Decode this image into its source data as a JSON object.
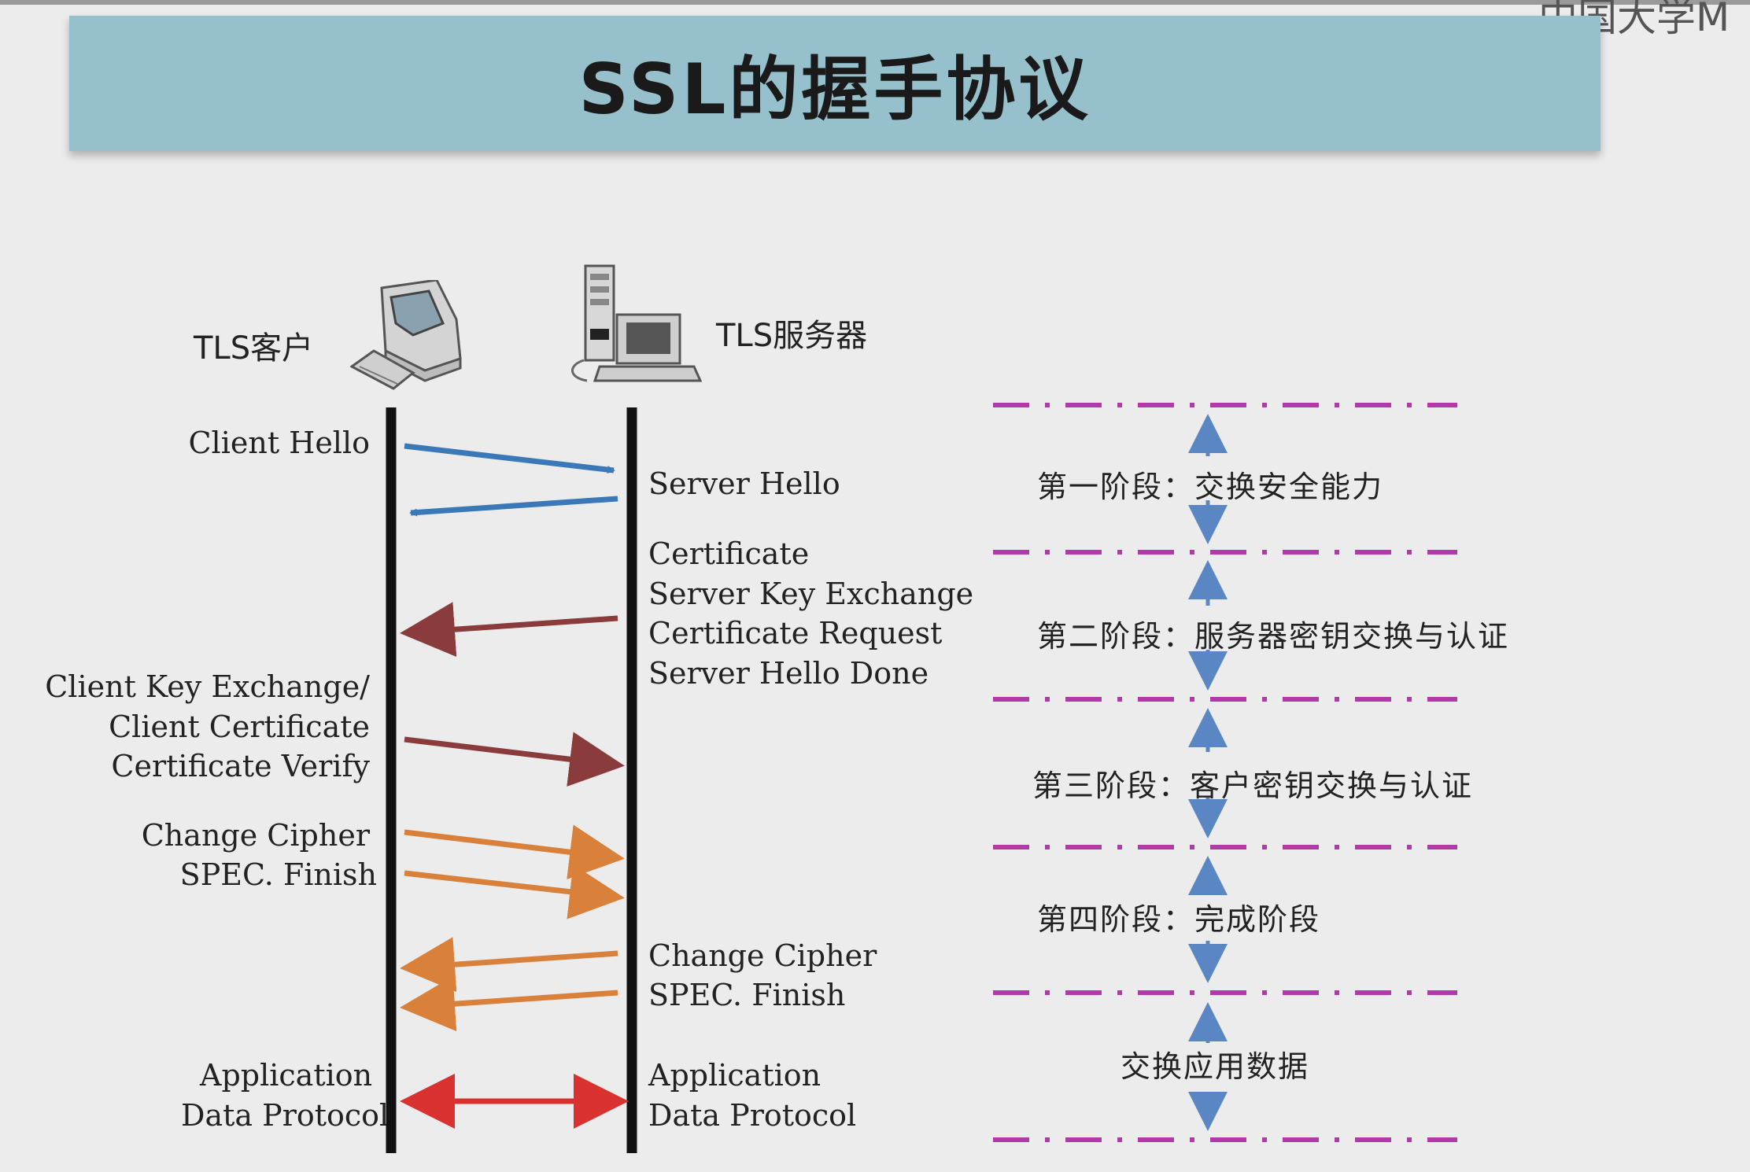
{
  "title": "SSL的握手协议",
  "corner_logo_text": "中国大学M",
  "client_label": "TLS客户",
  "server_label": "TLS服务器",
  "client_messages": {
    "client_hello": "Client Hello",
    "key_exchange": [
      "Client Key Exchange/",
      "Client Certificate",
      "Certificate Verify"
    ],
    "change_cipher": [
      "Change Cipher",
      "SPEC. Finish"
    ],
    "app_data": [
      "Application",
      "Data Protocol"
    ]
  },
  "server_messages": {
    "server_hello": "Server Hello",
    "certificates": [
      "Certificate",
      "Server Key Exchange",
      "Certificate Request",
      "Server Hello Done"
    ],
    "change_cipher": [
      "Change Cipher",
      "SPEC. Finish"
    ],
    "app_data": [
      "Application",
      "Data Protocol"
    ]
  },
  "phases": [
    "第一阶段：交换安全能力",
    "第二阶段：服务器密钥交换与认证",
    "第三阶段：客户密钥交换与认证",
    "第四阶段：完成阶段",
    "交换应用数据"
  ],
  "colors": {
    "banner": "#96c0cb",
    "phase1_arrow": "#3a78b8",
    "phase2_arrow": "#8a3b3b",
    "phase4_arrow": "#d9803a",
    "app_arrow": "#d93030",
    "divider": "#b23aa8",
    "phase_arrow": "#5b86c4"
  },
  "icons": {
    "client": "desktop-computer-icon",
    "server": "server-tower-icon"
  }
}
